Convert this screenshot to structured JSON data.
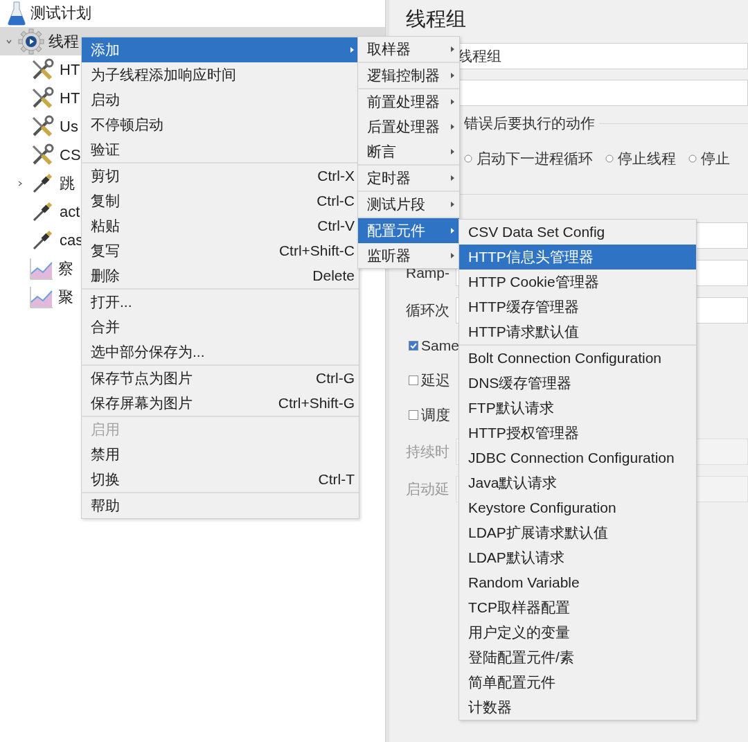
{
  "tree": {
    "items": [
      {
        "label": "测试计划",
        "kind": "flask",
        "selected": false,
        "children": [
          {
            "label": "线程",
            "kind": "gear",
            "selected": true,
            "expanded": true,
            "children": [
              {
                "label": "HT",
                "kind": "tools",
                "selected": false
              },
              {
                "label": "HT",
                "kind": "tools",
                "selected": false
              },
              {
                "label": "Us",
                "kind": "tools",
                "selected": false
              },
              {
                "label": "CS",
                "kind": "tools",
                "selected": false
              },
              {
                "label": "跳",
                "kind": "pipette",
                "selected": false,
                "expanded": false
              },
              {
                "label": "act",
                "kind": "pipette",
                "selected": false
              },
              {
                "label": "cas",
                "kind": "pipette",
                "selected": false
              },
              {
                "label": "察",
                "kind": "chart",
                "selected": false
              },
              {
                "label": "聚",
                "kind": "chart",
                "selected": false
              }
            ]
          }
        ]
      }
    ]
  },
  "editor": {
    "title": "线程组",
    "name_field": {
      "value": "线程组"
    },
    "error_action": {
      "legend": "错误后要执行的动作",
      "options": [
        {
          "label": "启动下一进程循环",
          "selected": false
        },
        {
          "label": "停止线程",
          "selected": false
        },
        {
          "label": "停止",
          "selected": false
        }
      ]
    },
    "thread_properties": {
      "rows": [
        {
          "kind": "field",
          "disabled": false
        },
        {
          "kind": "field",
          "label": "Ramp-",
          "disabled": false
        },
        {
          "kind": "field",
          "label": "循环次",
          "disabled": false
        },
        {
          "kind": "checkbox",
          "label": "Same",
          "checked": true
        },
        {
          "kind": "checkbox",
          "label": "延迟",
          "checked": false
        },
        {
          "kind": "checkbox",
          "label": "调度",
          "checked": false
        },
        {
          "kind": "field",
          "label": "持续时",
          "disabled": true
        },
        {
          "kind": "field",
          "label": "启动延",
          "disabled": true
        }
      ]
    }
  },
  "context_menu": {
    "groups": [
      [
        {
          "label": "添加",
          "submenu": true,
          "selected": true,
          "disabled": false
        },
        {
          "label": "为子线程添加响应时间",
          "selected": false,
          "disabled": false
        },
        {
          "label": "启动",
          "selected": false,
          "disabled": false
        },
        {
          "label": "不停顿启动",
          "selected": false,
          "disabled": false
        },
        {
          "label": "验证",
          "selected": false,
          "disabled": false
        }
      ],
      [
        {
          "label": "剪切",
          "shortcut": "Ctrl-X",
          "selected": false,
          "disabled": false
        },
        {
          "label": "复制",
          "shortcut": "Ctrl-C",
          "selected": false,
          "disabled": false
        },
        {
          "label": "粘贴",
          "shortcut": "Ctrl-V",
          "selected": false,
          "disabled": false
        },
        {
          "label": "复写",
          "shortcut": "Ctrl+Shift-C",
          "selected": false,
          "disabled": false
        },
        {
          "label": "删除",
          "shortcut": "Delete",
          "selected": false,
          "disabled": false
        }
      ],
      [
        {
          "label": "打开...",
          "selected": false,
          "disabled": false
        },
        {
          "label": "合并",
          "selected": false,
          "disabled": false
        },
        {
          "label": "选中部分保存为...",
          "selected": false,
          "disabled": false
        }
      ],
      [
        {
          "label": "保存节点为图片",
          "shortcut": "Ctrl-G",
          "selected": false,
          "disabled": false
        },
        {
          "label": "保存屏幕为图片",
          "shortcut": "Ctrl+Shift-G",
          "selected": false,
          "disabled": false
        }
      ],
      [
        {
          "label": "启用",
          "selected": false,
          "disabled": true
        },
        {
          "label": "禁用",
          "selected": false,
          "disabled": false
        },
        {
          "label": "切换",
          "shortcut": "Ctrl-T",
          "selected": false,
          "disabled": false
        }
      ],
      [
        {
          "label": "帮助",
          "selected": false,
          "disabled": false
        }
      ]
    ]
  },
  "add_submenu": {
    "groups": [
      [
        {
          "label": "取样器",
          "submenu": true,
          "selected": false
        }
      ],
      [
        {
          "label": "逻辑控制器",
          "submenu": true,
          "selected": false
        }
      ],
      [
        {
          "label": "前置处理器",
          "submenu": true,
          "selected": false
        },
        {
          "label": "后置处理器",
          "submenu": true,
          "selected": false
        },
        {
          "label": "断言",
          "submenu": true,
          "selected": false
        }
      ],
      [
        {
          "label": "定时器",
          "submenu": true,
          "selected": false
        }
      ],
      [
        {
          "label": "测试片段",
          "submenu": true,
          "selected": false
        }
      ],
      [
        {
          "label": "配置元件",
          "submenu": true,
          "selected": true
        },
        {
          "label": "监听器",
          "submenu": true,
          "selected": false
        }
      ]
    ]
  },
  "config_submenu": {
    "groups": [
      [
        {
          "label": "CSV Data Set Config",
          "selected": false
        },
        {
          "label": "HTTP信息头管理器",
          "selected": true
        },
        {
          "label": "HTTP Cookie管理器",
          "selected": false
        },
        {
          "label": "HTTP缓存管理器",
          "selected": false
        },
        {
          "label": "HTTP请求默认值",
          "selected": false
        }
      ],
      [
        {
          "label": "Bolt Connection Configuration",
          "selected": false
        },
        {
          "label": "DNS缓存管理器",
          "selected": false
        },
        {
          "label": "FTP默认请求",
          "selected": false
        },
        {
          "label": "HTTP授权管理器",
          "selected": false
        },
        {
          "label": "JDBC Connection Configuration",
          "selected": false
        },
        {
          "label": "Java默认请求",
          "selected": false
        },
        {
          "label": "Keystore Configuration",
          "selected": false
        },
        {
          "label": "LDAP扩展请求默认值",
          "selected": false
        },
        {
          "label": "LDAP默认请求",
          "selected": false
        },
        {
          "label": "Random Variable",
          "selected": false
        },
        {
          "label": "TCP取样器配置",
          "selected": false
        },
        {
          "label": "用户定义的变量",
          "selected": false
        },
        {
          "label": "登陆配置元件/素",
          "selected": false
        },
        {
          "label": "简单配置元件",
          "selected": false
        },
        {
          "label": "计数器",
          "selected": false
        }
      ]
    ]
  }
}
